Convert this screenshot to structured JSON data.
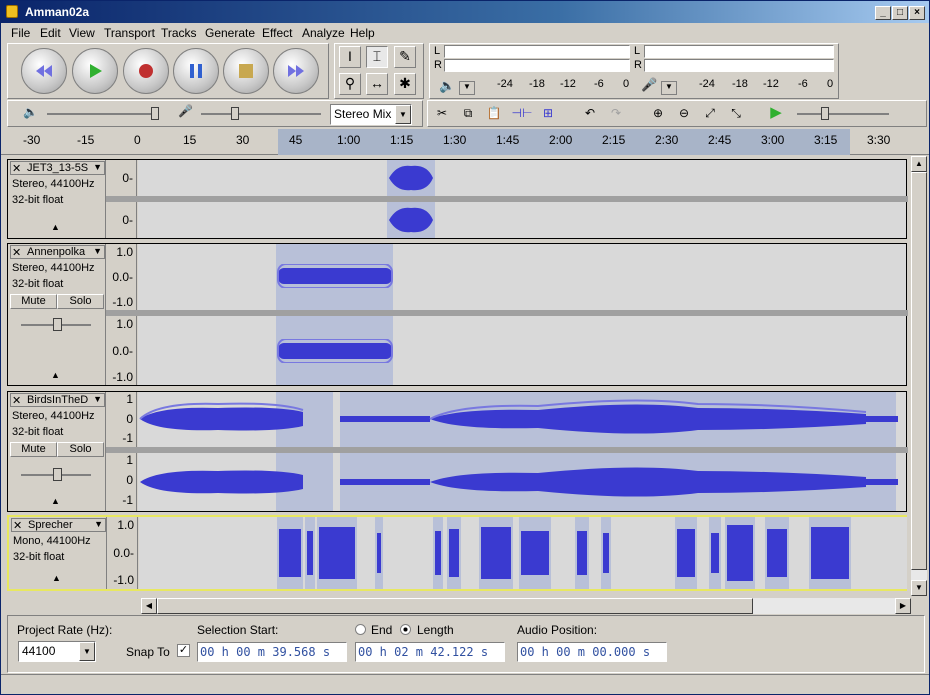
{
  "window": {
    "title": "Amman02a",
    "minimize": "_",
    "maximize": "□",
    "close": "×"
  },
  "menu": [
    "File",
    "Edit",
    "View",
    "Transport",
    "Tracks",
    "Generate",
    "Effect",
    "Analyze",
    "Help"
  ],
  "transport": [
    {
      "name": "skip-start",
      "glyph": "⏮",
      "color": "#6060d0"
    },
    {
      "name": "play",
      "glyph": "▶",
      "color": "#30a030"
    },
    {
      "name": "record",
      "glyph": "●",
      "color": "#c03030"
    },
    {
      "name": "pause",
      "glyph": "❚❚",
      "color": "#3060c0"
    },
    {
      "name": "stop",
      "glyph": "■",
      "color": "#c0a040"
    },
    {
      "name": "skip-end",
      "glyph": "⏭",
      "color": "#6060d0"
    }
  ],
  "tools": [
    "I",
    "⌶",
    "✎",
    "⚲",
    "↔",
    "✱"
  ],
  "meters": {
    "left": "L",
    "right": "R",
    "scale": [
      "-24",
      "-18",
      "-12",
      "-6",
      "0"
    ]
  },
  "mixer": {
    "input_source": "Stereo Mix"
  },
  "edit_tools": [
    "✂",
    "⧉",
    "📋",
    "⊣⊢",
    "⊞",
    "↶",
    "↷",
    "⊕",
    "⊖",
    "⤢",
    "⤡",
    "▶"
  ],
  "ruler": [
    "-30",
    "-15",
    "0",
    "15",
    "30",
    "45",
    "1:00",
    "1:15",
    "1:30",
    "1:45",
    "2:00",
    "2:15",
    "2:30",
    "2:45",
    "3:00",
    "3:15",
    "3:30"
  ],
  "tracks": [
    {
      "name": "JET3_13-5S",
      "format": "Stereo, 44100Hz",
      "bits": "32-bit float",
      "scale": [
        "0-"
      ],
      "scale2": [
        "0-"
      ]
    },
    {
      "name": "Annenpolka",
      "format": "Stereo, 44100Hz",
      "bits": "32-bit float",
      "mute": "Mute",
      "solo": "Solo",
      "scale": [
        "1.0",
        "0.0-",
        "-1.0"
      ],
      "scale2": [
        "1.0",
        "0.0-",
        "-1.0"
      ]
    },
    {
      "name": "BirdsInTheD",
      "format": "Stereo, 44100Hz",
      "bits": "32-bit float",
      "mute": "Mute",
      "solo": "Solo",
      "scale": [
        "1",
        "0",
        "-1"
      ],
      "scale2": [
        "1",
        "0",
        "-1"
      ]
    },
    {
      "name": "Sprecher",
      "format": "Mono, 44100Hz",
      "bits": "32-bit float",
      "scale": [
        "1.0",
        "0.0-",
        "-1.0"
      ]
    }
  ],
  "bottom": {
    "rate_label": "Project Rate (Hz):",
    "rate_value": "44100",
    "snap_label": "Snap To",
    "sel_start_label": "Selection Start:",
    "sel_start": "00 h 00 m 39.568 s",
    "end_label": "End",
    "length_label": "Length",
    "sel_end": "00 h 02 m 42.122 s",
    "audio_pos_label": "Audio Position:",
    "audio_pos": "00 h 00 m 00.000 s"
  },
  "colors": {
    "wave": "#3a3ad0",
    "env": "#7878e0",
    "selection": "#b8c0d8"
  }
}
